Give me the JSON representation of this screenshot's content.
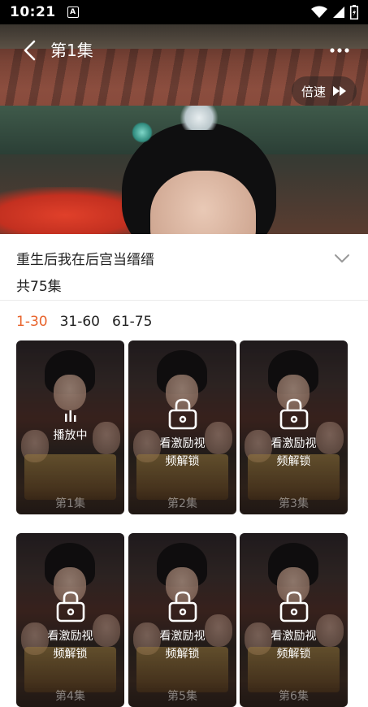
{
  "status_bar": {
    "time": "10:21",
    "notification_letter": "A"
  },
  "player": {
    "episode_title": "第1集",
    "speed_label": "倍速"
  },
  "drama": {
    "title": "重生后我在后宫当缙缙",
    "episode_count": "共75集"
  },
  "range_tabs": [
    {
      "label": "1-30",
      "active": true
    },
    {
      "label": "31-60",
      "active": false
    },
    {
      "label": "61-75",
      "active": false
    }
  ],
  "episodes": [
    {
      "label": "第1集",
      "status": "playing",
      "status_text": "播放中"
    },
    {
      "label": "第2集",
      "status": "locked",
      "status_text": "看激励视\n频解锁"
    },
    {
      "label": "第3集",
      "status": "locked",
      "status_text": "看激励视\n频解锁"
    },
    {
      "label": "第4集",
      "status": "locked",
      "status_text": "看激励视\n频解锁"
    },
    {
      "label": "第5集",
      "status": "locked",
      "status_text": "看激励视\n频解锁"
    },
    {
      "label": "第6集",
      "status": "locked",
      "status_text": "看激励视\n频解锁"
    }
  ],
  "colors": {
    "accent": "#e8632b"
  }
}
